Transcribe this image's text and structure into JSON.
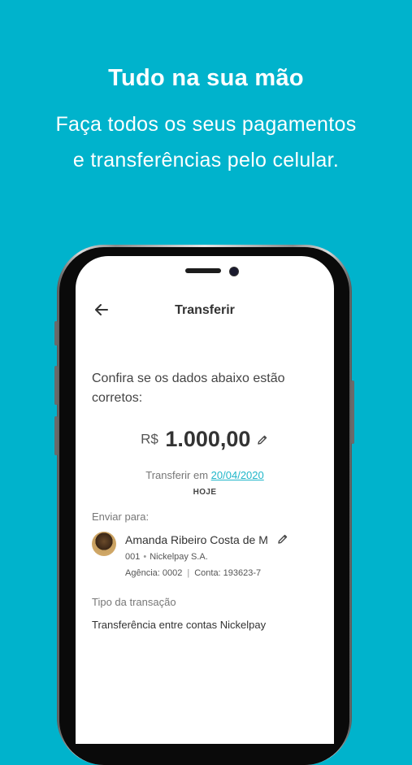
{
  "promo": {
    "headline": "Tudo na sua mão",
    "subline_1": "Faça todos os seus pagamentos",
    "subline_2": "e transferências pelo celular."
  },
  "header": {
    "back_icon": "arrow-left-icon",
    "title": "Transferir"
  },
  "confirm_text": "Confira se os dados abaixo estão corretos:",
  "amount": {
    "currency": "R$",
    "value": "1.000,00",
    "edit_icon": "pencil-icon"
  },
  "schedule": {
    "prefix": "Transferir em",
    "date": "20/04/2020",
    "day_label": "HOJE"
  },
  "recipient": {
    "label": "Enviar para:",
    "name": "Amanda Ribeiro Costa de M",
    "bank_code": "001",
    "bank_name": "Nickelpay S.A.",
    "agency": "Agência: 0002",
    "account": "Conta: 193623-7",
    "edit_icon": "pencil-icon"
  },
  "transaction": {
    "label": "Tipo da transação",
    "value": "Transferência entre contas Nickelpay"
  },
  "colors": {
    "background": "#00b3cc",
    "link": "#1fb6c9"
  }
}
